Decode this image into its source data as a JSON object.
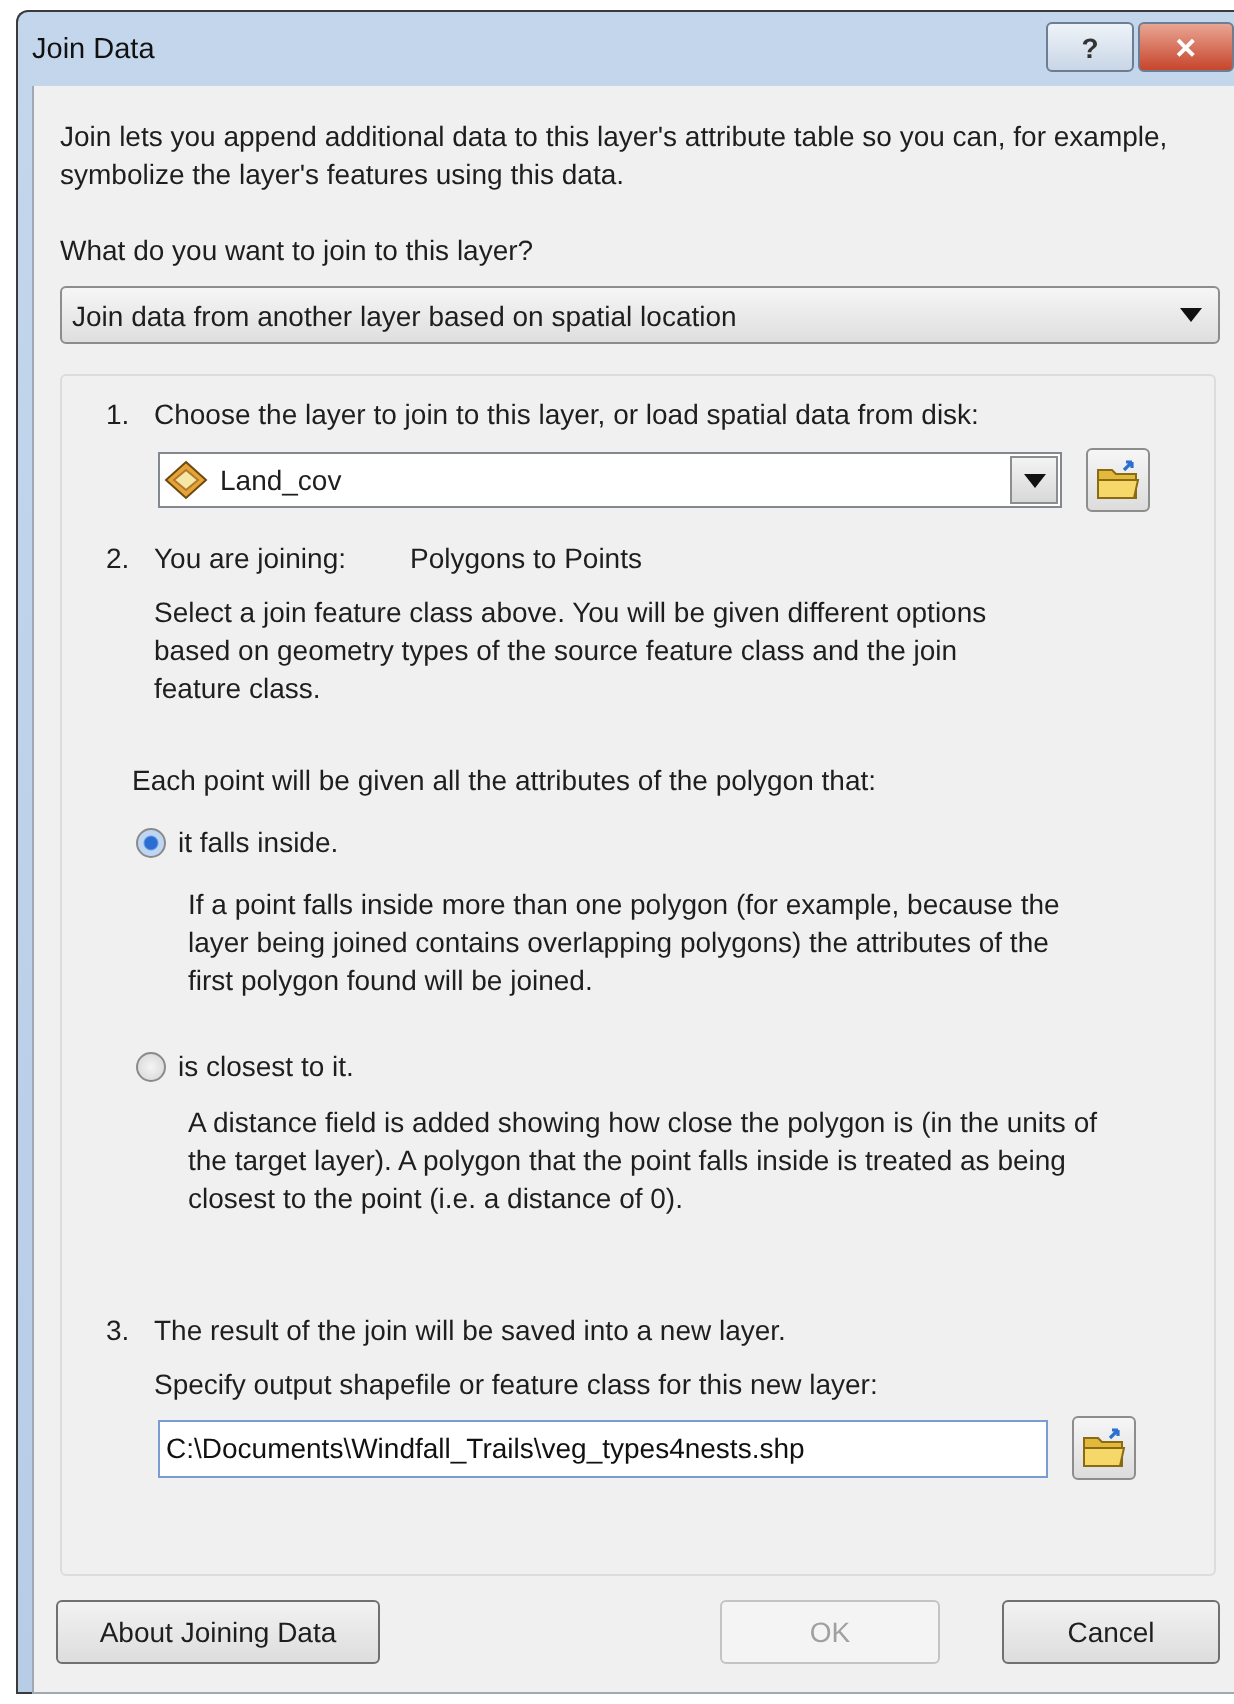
{
  "window": {
    "title": "Join Data",
    "controls": [
      {
        "kind": "help",
        "label": "?"
      },
      {
        "kind": "close",
        "label": "✕"
      }
    ]
  },
  "intro": "Join lets you append additional data to this layer's attribute table so you can, for example, symbolize the layer's features using this data.",
  "join_question": "What do you want to join to this layer?",
  "join_type": {
    "value": "Join data from another layer based on spatial location"
  },
  "step_1": {
    "number": "1.",
    "text": "Choose the layer to join to this layer, or load spatial data from disk:",
    "layer": {
      "value": "Land_cov"
    }
  },
  "step_2": {
    "number": "2.",
    "label": "You are joining:",
    "value": "Polygons to Points",
    "description": "Select a join feature class above.  You will be given different options based on geometry types of the source feature class and the join feature class."
  },
  "options_prompt": "Each point will be given all the attributes of the polygon that:",
  "options": [
    {
      "label": "it falls inside.",
      "selected": true,
      "description": "If a point falls inside more than one polygon (for example, because the layer being joined contains overlapping polygons) the attributes of the first polygon found will be joined."
    },
    {
      "label": "is closest to it.",
      "selected": false,
      "description": "A distance field is added showing how close the polygon is (in the units of the target layer). A polygon that the point falls inside is treated as being closest to the point (i.e. a distance of 0)."
    }
  ],
  "step_3": {
    "number": "3.",
    "text": "The result of the join will be saved into a new layer.",
    "prompt": "Specify output shapefile or feature class for this new layer:",
    "output": {
      "value": "C:\\Documents\\Windfall_Trails\\veg_types4nests.shp"
    }
  },
  "buttons": [
    {
      "label": "About Joining Data",
      "disabled": false
    },
    {
      "label": "OK",
      "disabled": true
    },
    {
      "label": "Cancel",
      "disabled": false
    }
  ]
}
